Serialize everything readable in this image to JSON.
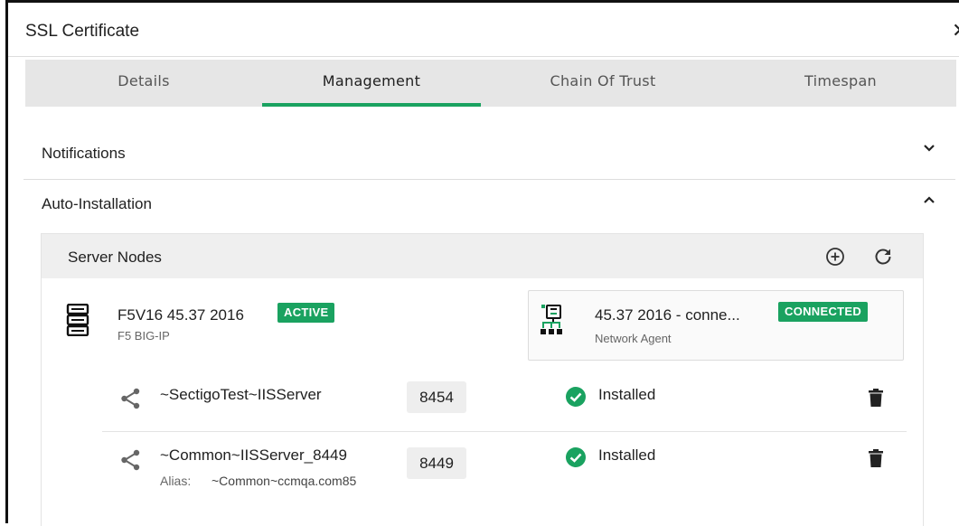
{
  "dialog": {
    "title": "SSL Certificate",
    "close_glyph": "✕"
  },
  "tabs": [
    {
      "label": "Details"
    },
    {
      "label": "Management"
    },
    {
      "label": "Chain Of Trust"
    },
    {
      "label": "Timespan"
    }
  ],
  "active_tab": "Management",
  "sections": {
    "notifications": {
      "title": "Notifications",
      "expanded": false
    },
    "auto_installation": {
      "title": "Auto-Installation",
      "expanded": true
    }
  },
  "server_nodes": {
    "title": "Server Nodes",
    "add_icon": "add-circle-icon",
    "refresh_icon": "refresh-icon",
    "node": {
      "name": "F5V16 45.37 2016",
      "type": "F5 BIG-IP",
      "status": "ACTIVE",
      "icon": "server-icon"
    },
    "agent": {
      "name": "45.37 2016 - conne...",
      "type": "Network Agent",
      "status": "CONNECTED",
      "icon": "network-agent-icon"
    },
    "sites": [
      {
        "name": "~SectigoTest~IISServer",
        "port": "8454",
        "status": "Installed",
        "alias_label": "",
        "alias": ""
      },
      {
        "name": "~Common~IISServer_8449",
        "port": "8449",
        "status": "Installed",
        "alias_label": "Alias:",
        "alias": "~Common~ccmqa.com85"
      }
    ]
  },
  "colors": {
    "accent": "#1aa260",
    "tab_bar": "#e6e6e6",
    "card_header": "#efefef"
  }
}
